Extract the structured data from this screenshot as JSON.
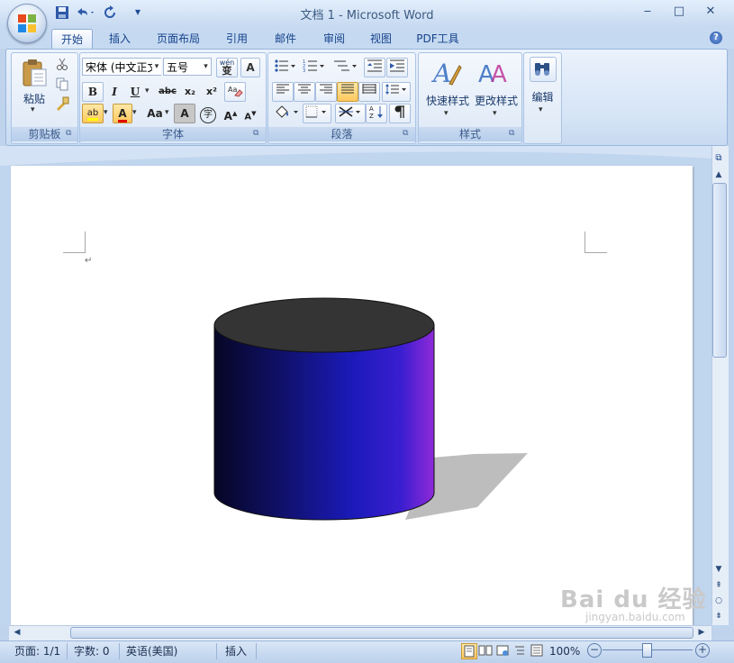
{
  "window": {
    "title": "文档 1 - Microsoft Word",
    "minimize": "‒",
    "maximize": "□",
    "close": "✕"
  },
  "quick_access": {
    "customize": "▾"
  },
  "tabs": [
    {
      "label": "开始",
      "active": true
    },
    {
      "label": "插入"
    },
    {
      "label": "页面布局"
    },
    {
      "label": "引用"
    },
    {
      "label": "邮件"
    },
    {
      "label": "审阅"
    },
    {
      "label": "视图"
    },
    {
      "label": "PDF工具"
    }
  ],
  "help_label": "?",
  "ribbon": {
    "clipboard": {
      "paste_label": "粘贴",
      "group_label": "剪贴板"
    },
    "font": {
      "font_name": "宋体 (中文正文)",
      "font_size": "五号",
      "wen_label": "wén",
      "wen_char": "变",
      "a_box": "A",
      "bold": "B",
      "italic": "I",
      "underline": "U",
      "strike": "abc",
      "sub": "x₂",
      "sup": "x²",
      "abc_clear": "A",
      "highlight": "ab",
      "font_color": "A",
      "aa": "Aa",
      "char_shading": "A",
      "enclose": "字",
      "grow": "A",
      "shrink": "A",
      "group_label": "字体"
    },
    "paragraph": {
      "group_label": "段落"
    },
    "styles": {
      "quick_styles": "快速样式",
      "change_styles": "更改样式",
      "group_label": "样式"
    },
    "editing": {
      "label": "编辑"
    }
  },
  "document": {
    "paragraph_mark": "↵",
    "shape": "cylinder",
    "colors": {
      "top": "#343434",
      "body_left": "#060625",
      "body_mid": "#1a1ab8",
      "body_right": "#8f2ad8",
      "shadow": "#bdbdbd"
    }
  },
  "status_bar": {
    "page": "页面: 1/1",
    "words": "字数: 0",
    "language": "英语(美国)",
    "mode": "插入",
    "zoom": "100%"
  },
  "watermark": {
    "brand": "Bai du 经验",
    "url": "jingyan.baidu.com"
  }
}
